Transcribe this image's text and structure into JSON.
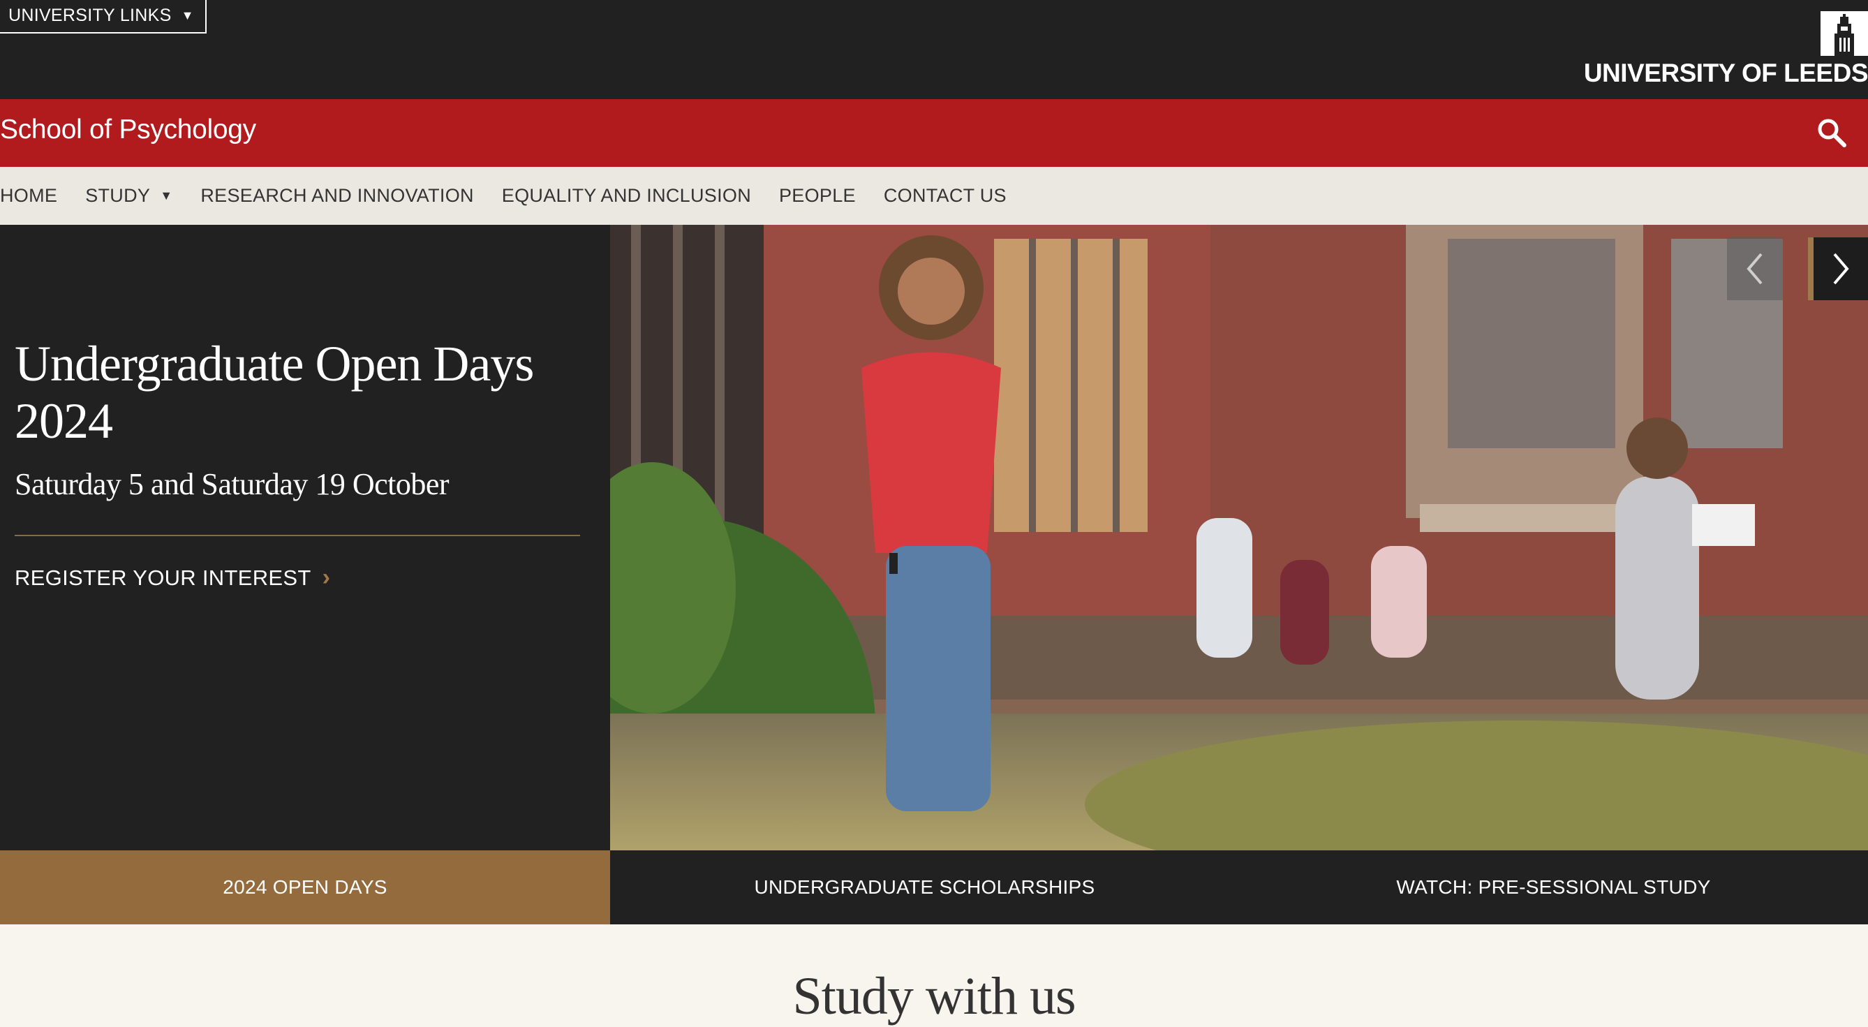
{
  "topbar": {
    "university_links_label": "UNIVERSITY LINKS",
    "logo_text": "UNIVERSITY OF LEEDS"
  },
  "header": {
    "school_name": "School of Psychology"
  },
  "nav": {
    "items": [
      {
        "label": "HOME"
      },
      {
        "label": "STUDY"
      },
      {
        "label": "RESEARCH AND INNOVATION"
      },
      {
        "label": "EQUALITY AND INCLUSION"
      },
      {
        "label": "PEOPLE"
      },
      {
        "label": "CONTACT US"
      }
    ]
  },
  "hero": {
    "title": "Undergraduate Open Days 2024",
    "subtitle": "Saturday 5 and Saturday 19 October",
    "cta": "REGISTER YOUR INTEREST"
  },
  "tabs": [
    {
      "label": "2024 OPEN DAYS"
    },
    {
      "label": "UNDERGRADUATE SCHOLARSHIPS"
    },
    {
      "label": "WATCH: PRE-SESSIONAL STUDY"
    }
  ],
  "section": {
    "heading": "Study with us"
  },
  "colors": {
    "topbar": "#212121",
    "brand_red": "#b21b1e",
    "nav_bg": "#ebe8e2",
    "gold": "#946b3d",
    "page_bg": "#f8f5ef"
  }
}
